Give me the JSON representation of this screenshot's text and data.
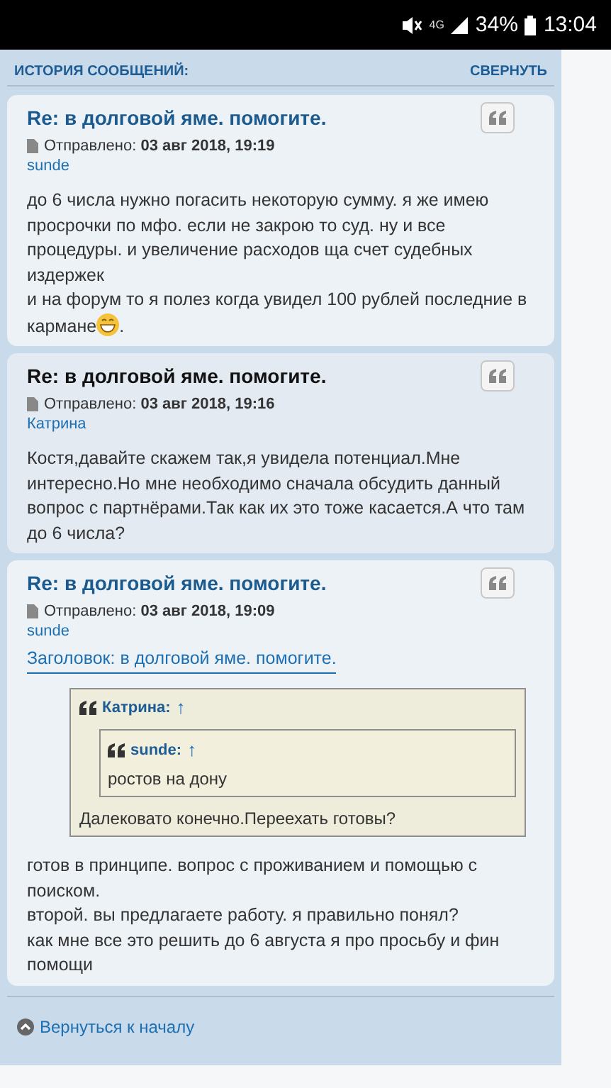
{
  "status_bar": {
    "network": "4G",
    "battery": "34%",
    "time": "13:04"
  },
  "history": {
    "title": "ИСТОРИЯ СООБЩЕНИЙ:",
    "collapse": "СВЕРНУТЬ"
  },
  "posts": [
    {
      "title": "Re: в долговой яме. помогите.",
      "active": false,
      "sent_label": "Отправлено:",
      "date": "03 авг 2018, 19:19",
      "author": "sunde",
      "body": [
        {
          "text": "до 6 числа нужно погасить некоторую сумму. я же имею просрочки по мфо. если не закрою то суд. ну и все процедуры. и увеличение расходов ща счет судебных издержек"
        },
        {
          "text": "и на форум то я полез когда увидел 100 рублей последние в",
          "tail": "кармане",
          "emoji": true,
          "after": "."
        }
      ]
    },
    {
      "title": "Re: в долговой яме. помогите.",
      "active": true,
      "sent_label": "Отправлено:",
      "date": "03 авг 2018, 19:16",
      "author": "Катрина",
      "body": [
        {
          "text": "Костя,давайте скажем так,я увидела потенциал.Мне интересно.Но мне необходимо сначала обсудить данный вопрос с партнёрами.Так как их это тоже касается.А что там до 6 числа?"
        }
      ]
    },
    {
      "title": "Re: в долговой яме. помогите.",
      "active": false,
      "sent_label": "Отправлено:",
      "date": "03 авг 2018, 19:09",
      "author": "sunde",
      "subject": "Заголовок: в долговой яме. помогите.",
      "quote": {
        "author": "Катрина:",
        "arrow": "↑",
        "nested": {
          "author": "sunde:",
          "arrow": "↑",
          "text": "ростов на дону"
        },
        "text": "Далековато конечно.Переехать готовы?"
      },
      "body": [
        {
          "text": "готов в принципе. вопрос с проживанием и помощью с поиском."
        },
        {
          "text": "второй. вы предлагаете работу. я правильно понял?"
        },
        {
          "text": "как мне все это решить до 6 августа я про просьбу и фин помощи"
        }
      ]
    }
  ],
  "back_link": "Вернуться к началу"
}
